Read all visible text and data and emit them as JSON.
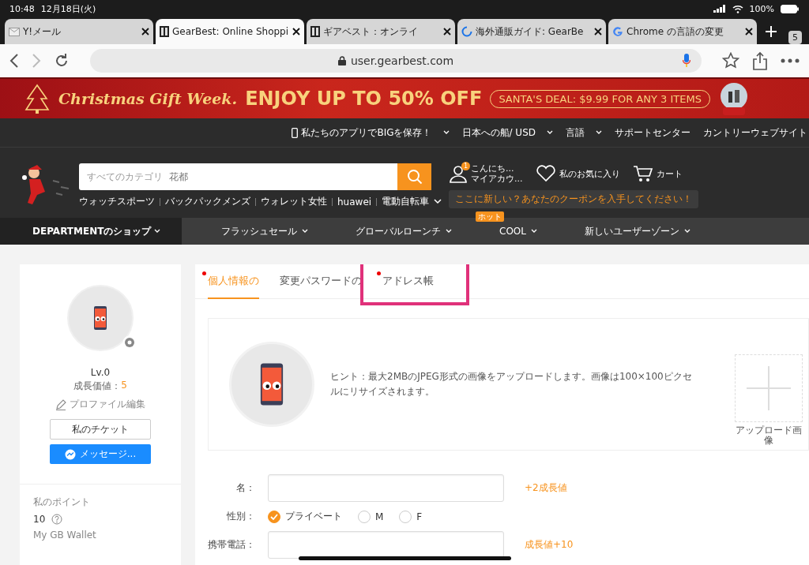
{
  "status_bar": {
    "time": "10:48",
    "date": "12月18日(火)",
    "battery": "100%"
  },
  "browser_tabs": [
    {
      "title": "Y!メール",
      "kind": "mail",
      "selected": false
    },
    {
      "title": "GearBest: Online Shoppi",
      "kind": "site",
      "selected": true
    },
    {
      "title": "ギアベスト：オンライ",
      "kind": "site",
      "selected": false
    },
    {
      "title": "海外通販ガイド: GearBe",
      "kind": "loading",
      "selected": false
    },
    {
      "title": "Chrome の言語の変更",
      "kind": "search",
      "selected": false
    }
  ],
  "tab_count": "5",
  "address_bar": {
    "url": "user.gearbest.com"
  },
  "banner": {
    "title": "Christmas Gift Week.",
    "headline": "ENJOY UP TO 50% OFF",
    "deal": "SANTA'S DEAL: $9.99 FOR ANY 3 ITEMS"
  },
  "top_links": [
    {
      "label": "私たちのアプリでBIGを保存！",
      "phone_icon": true,
      "dropdown": true
    },
    {
      "label": "日本への船/ USD",
      "phone_icon": false,
      "dropdown": true
    },
    {
      "label": "言語",
      "phone_icon": false,
      "dropdown": true
    },
    {
      "label": "サポートセンター",
      "phone_icon": false,
      "dropdown": false
    },
    {
      "label": "カントリーウェブサイト",
      "phone_icon": false,
      "dropdown": false
    }
  ],
  "search": {
    "category": "すべてのカテゴリ",
    "placeholder": "花都"
  },
  "hot_keywords": [
    "ウォッチスポーツ",
    "バックパックメンズ",
    "ウォレット女性",
    "huawei",
    "電動自転車"
  ],
  "account": {
    "badge": "1",
    "greeting": "こんにち...",
    "label": "マイアカウ..."
  },
  "wishlist": "私のお気に入り",
  "cart": "カート",
  "coupon": "ここに新しい？あなたのクーポンを入手してください！",
  "nav": {
    "department": "DEPARTMENTのショップ",
    "items": [
      {
        "label": "フラッシュセール"
      },
      {
        "label": "グローバルローンチ"
      },
      {
        "label": "COOL",
        "badge": "ホット"
      },
      {
        "label": "新しいユーザーゾーン"
      }
    ]
  },
  "profile": {
    "level": "Lv.0",
    "growth_label": "成長価値：",
    "growth_value": "5",
    "edit": "プロファイル編集",
    "tickets": "私のチケット",
    "message": "メッセージ...",
    "points_label": "私のポイント",
    "points": "10",
    "wallet_label": "My GB Wallet"
  },
  "account_tabs": [
    {
      "label": "個人情報の",
      "selected": true,
      "dot": true,
      "highlighted": false
    },
    {
      "label": "変更パスワードの",
      "selected": false,
      "dot": false,
      "highlighted": false
    },
    {
      "label": "アドレス帳",
      "selected": false,
      "dot": true,
      "highlighted": true
    }
  ],
  "upload": {
    "hint": "ヒント：最大2MBのJPEG形式の画像をアップロードします。画像は100×100ピクセルにリサイズされます。",
    "button": "アップロード画像"
  },
  "form": [
    {
      "kind": "text",
      "label": "名：",
      "bonus": "+2成長値"
    },
    {
      "kind": "radio",
      "label": "性別：",
      "options": [
        {
          "label": "プライベート",
          "selected": true
        },
        {
          "label": "M",
          "selected": false
        },
        {
          "label": "F",
          "selected": false
        }
      ]
    },
    {
      "kind": "text",
      "label": "携帯電話：",
      "bonus": "成長値+10"
    }
  ]
}
